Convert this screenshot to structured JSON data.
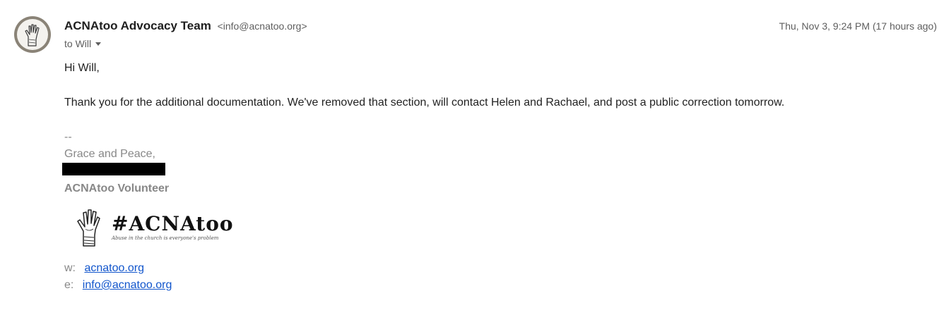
{
  "sender": {
    "name": "ACNAtoo Advocacy Team",
    "email": "<info@acnatoo.org>",
    "avatar_icon": "raised-hand-icon"
  },
  "timestamp": "Thu, Nov 3, 9:24 PM (17 hours ago)",
  "recipient": "to Will",
  "message": {
    "greeting": "Hi Will,",
    "paragraph": "Thank you for the additional documentation. We've removed that section, will contact Helen and Rachael, and post a public correction tomorrow."
  },
  "signature": {
    "delimiter": "--",
    "closing": "Grace and Peace,",
    "role": "ACNAtoo Volunteer",
    "logo_title": "#ACNAtoo",
    "logo_tagline": "Abuse in the church is everyone's problem",
    "logo_icon": "raised-hand-icon",
    "website_label": "w:",
    "website": "acnatoo.org",
    "email_label": "e:",
    "email": "info@acnatoo.org"
  },
  "colors": {
    "link": "#1155cc",
    "muted": "#888888",
    "redaction": "#000000"
  }
}
